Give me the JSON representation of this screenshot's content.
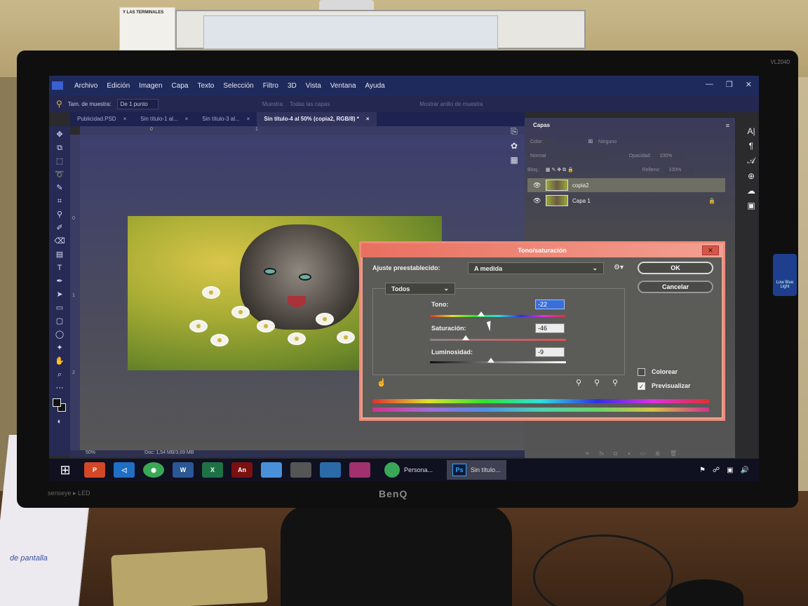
{
  "room": {
    "poster_text": "Y LAS TERMINALES",
    "papers_text": "de pantalla"
  },
  "monitor": {
    "brand": "BenQ",
    "model": "VL2040",
    "senseye": "senseye ▸ LED",
    "low_blue_light": "Low Blue Light"
  },
  "menu": {
    "items": [
      "Archivo",
      "Edición",
      "Imagen",
      "Capa",
      "Texto",
      "Selección",
      "Filtro",
      "3D",
      "Vista",
      "Ventana",
      "Ayuda"
    ]
  },
  "options_bar": {
    "sample_size_label": "Tam. de muestra:",
    "sample_size_value": "De 1 punto",
    "sample_label": "Muestra:",
    "sample_value": "Todas las capas",
    "show_ring": "Mostrar anillo de muestra"
  },
  "tabs": [
    {
      "label": "Publicidad.PSD",
      "active": false
    },
    {
      "label": "Sin título-1 al...",
      "active": false
    },
    {
      "label": "Sin título-3 al...",
      "active": false
    },
    {
      "label": "Sin título-4 al 50% (copia2, RGB/8) *",
      "active": true
    }
  ],
  "rulers": {
    "top": [
      "0",
      "1"
    ],
    "left": [
      "0",
      "1",
      "2"
    ]
  },
  "status": {
    "zoom": "50%",
    "doc": "Doc: 1,54 MB/3,69 MB"
  },
  "layers_panel": {
    "title": "Capas",
    "filter_label": "Color",
    "filter_value": "Ninguno",
    "blend_mode": "Normal",
    "opacity_label": "Opacidad:",
    "opacity_value": "100%",
    "lock_label": "Bloq.:",
    "fill_label": "Relleno:",
    "fill_value": "100%",
    "layers": [
      {
        "name": "copia2",
        "selected": true,
        "locked": false
      },
      {
        "name": "Capa 1",
        "selected": false,
        "locked": true
      }
    ]
  },
  "dialog": {
    "title": "Tono/saturación",
    "preset_label": "Ajuste preestablecido:",
    "preset_value": "A medida",
    "channel_value": "Todos",
    "ok_label": "OK",
    "cancel_label": "Cancelar",
    "hue_label": "Tono:",
    "hue_value": "-22",
    "saturation_label": "Saturación:",
    "saturation_value": "-46",
    "lightness_label": "Luminosidad:",
    "lightness_value": "-9",
    "colorize_label": "Colorear",
    "colorize_checked": false,
    "preview_label": "Previsualizar",
    "preview_checked": true
  },
  "taskbar": {
    "apps": [
      {
        "name": "PowerPoint",
        "glyph": "P",
        "color": "#d24726"
      },
      {
        "name": "Visual Studio Code",
        "glyph": "◁",
        "color": "#1f6fc5"
      },
      {
        "name": "Chrome",
        "glyph": "◉",
        "color": "#3aa757"
      },
      {
        "name": "Word",
        "glyph": "W",
        "color": "#2b5797"
      },
      {
        "name": "Excel",
        "glyph": "X",
        "color": "#1e7145"
      },
      {
        "name": "Animate",
        "glyph": "An",
        "color": "#7a1010"
      }
    ],
    "task_persona": "Persona...",
    "task_ps": "Sin título...",
    "ps_badge": "Ps"
  }
}
